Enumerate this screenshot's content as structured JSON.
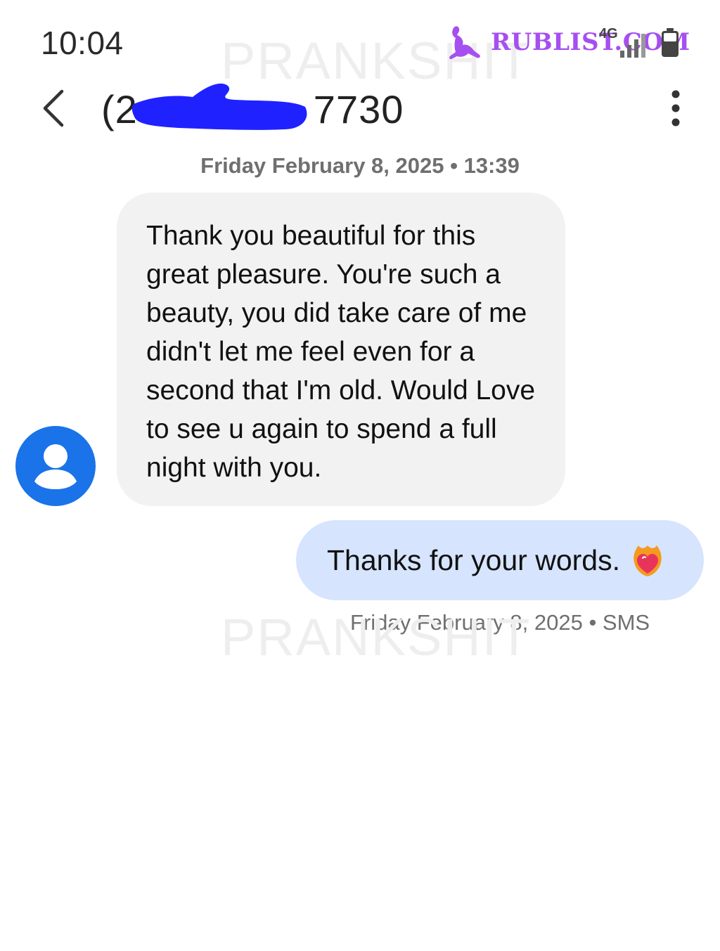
{
  "status_bar": {
    "time": "10:04",
    "network_label": "4G",
    "watermark_site": "RUBLIST.COM"
  },
  "watermark": {
    "text": "PRANKSHIT"
  },
  "header": {
    "contact_number_start": "(2",
    "contact_number_end": "7730"
  },
  "conversation": {
    "date_header": "Friday February 8, 2025 • 13:39",
    "incoming_message": "Thank you beautiful for this great pleasure. You're such a beauty, you did take care of me didn't let me feel even for a second that I'm old. Would Love to see u again to spend a full night with you.",
    "outgoing_message": "Thanks for your words.",
    "outgoing_meta": "Friday February 8, 2025 • SMS"
  },
  "colors": {
    "avatar": "#1a73e8",
    "incoming_bubble": "#f2f2f2",
    "outgoing_bubble": "#d6e5fd",
    "redaction": "#1f22ff",
    "watermark_brand": "#a64ff0"
  },
  "icons": {
    "back": "chevron-left-icon",
    "more": "more-vertical-icon",
    "avatar": "person-icon",
    "emoji": "heart-on-fire-emoji",
    "signal": "signal-bars-icon",
    "battery": "battery-icon"
  }
}
